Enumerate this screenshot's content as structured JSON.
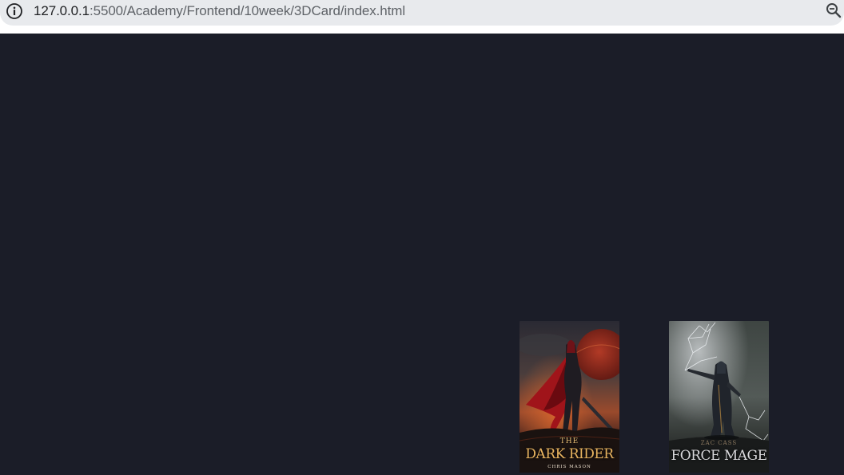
{
  "browser": {
    "url_host": "127.0.0.1",
    "url_rest": ":5500/Academy/Frontend/10week/3DCard/index.html",
    "site_info_icon": "info-icon",
    "zoom_icon": "zoom-out-icon"
  },
  "page": {
    "background_color": "#1b1d28",
    "cards": [
      {
        "title_small": "THE",
        "title_main": "DARK RIDER",
        "author": "CHRIS MASON"
      },
      {
        "author": "ZAC CASS",
        "title_main": "FORCE MAGE"
      }
    ]
  }
}
